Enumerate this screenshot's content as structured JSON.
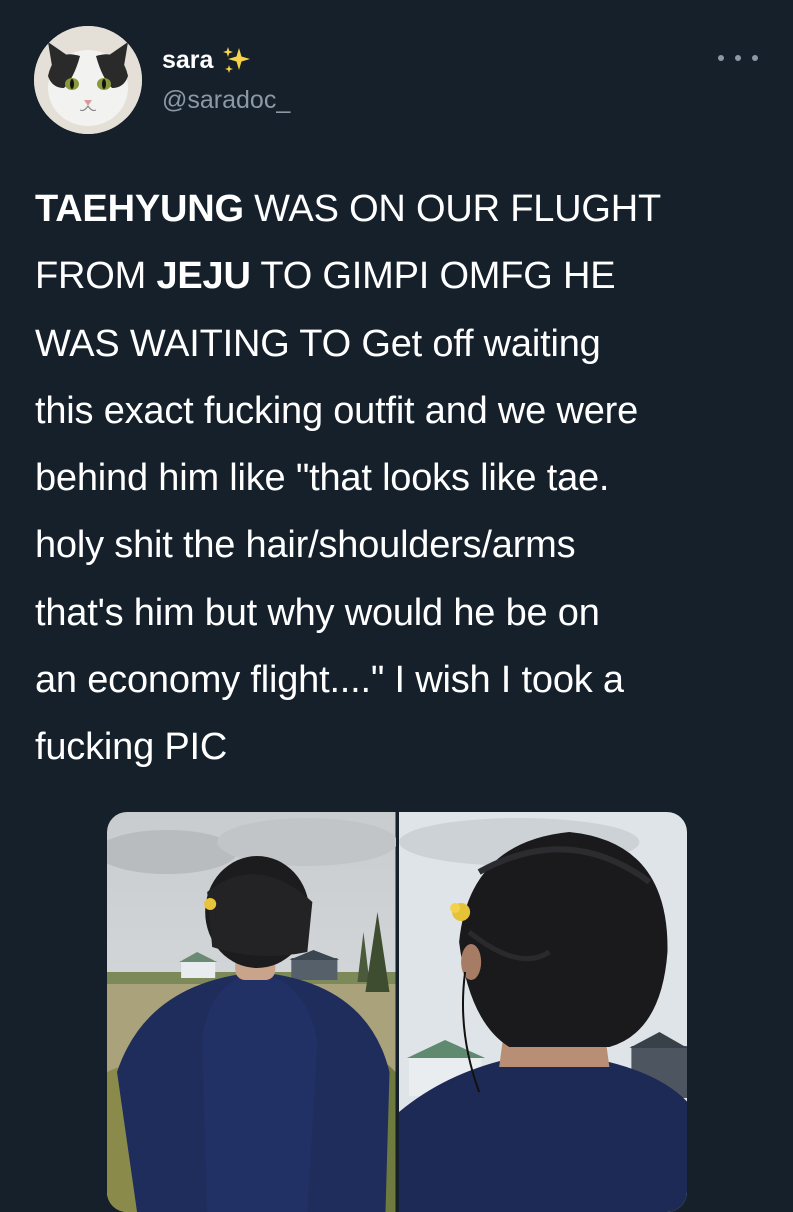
{
  "profile": {
    "display_name": "sara",
    "emoji_icon": "sparkles-icon",
    "handle": "@saradoc_",
    "avatar_icon": "cat-avatar"
  },
  "menu": {
    "icon": "more-dots-icon"
  },
  "tweet": {
    "lines": [
      {
        "bold": "TAEHYUNG",
        "rest": " WAS ON OUR FLUGHT"
      },
      {
        "pre": "FROM ",
        "bold": "JEJU",
        "rest": " TO GIMPI OMFG HE"
      },
      {
        "text": "WAS WAITING TO Get off waiting"
      },
      {
        "text": "this exact fucking outfit and we were"
      },
      {
        "text": "behind him like \"that looks like tae."
      },
      {
        "text": "holy shit the hair/shoulders/arms"
      },
      {
        "text": "that's him but why would he be on"
      },
      {
        "text": "an economy flight....\" I wish I took a"
      },
      {
        "text": "fucking PIC"
      }
    ]
  },
  "media": {
    "photos": [
      {
        "description_icon": "photo-man-back-field"
      },
      {
        "description_icon": "photo-man-back-closeup"
      }
    ]
  },
  "colors": {
    "background": "#15202b",
    "text": "#ffffff",
    "secondary": "#8b98a5"
  }
}
